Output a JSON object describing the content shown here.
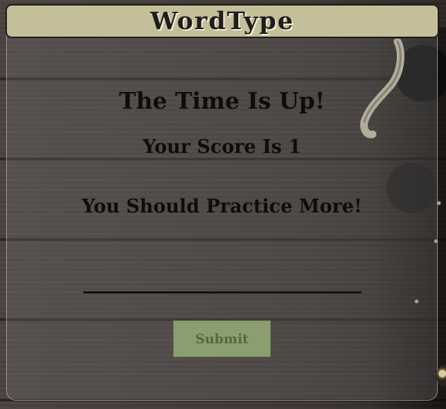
{
  "header": {
    "title": "WordType"
  },
  "result": {
    "time_message": "The Time Is Up!",
    "score_message": "Your Score Is 1",
    "advice_message": "You Should Practice More!"
  },
  "form": {
    "input_value": "",
    "submit_label": "Submit"
  },
  "colors": {
    "header_bg": "#c5bf99",
    "submit_bg": "#8a9e6f",
    "text": "#0d0d0d"
  }
}
